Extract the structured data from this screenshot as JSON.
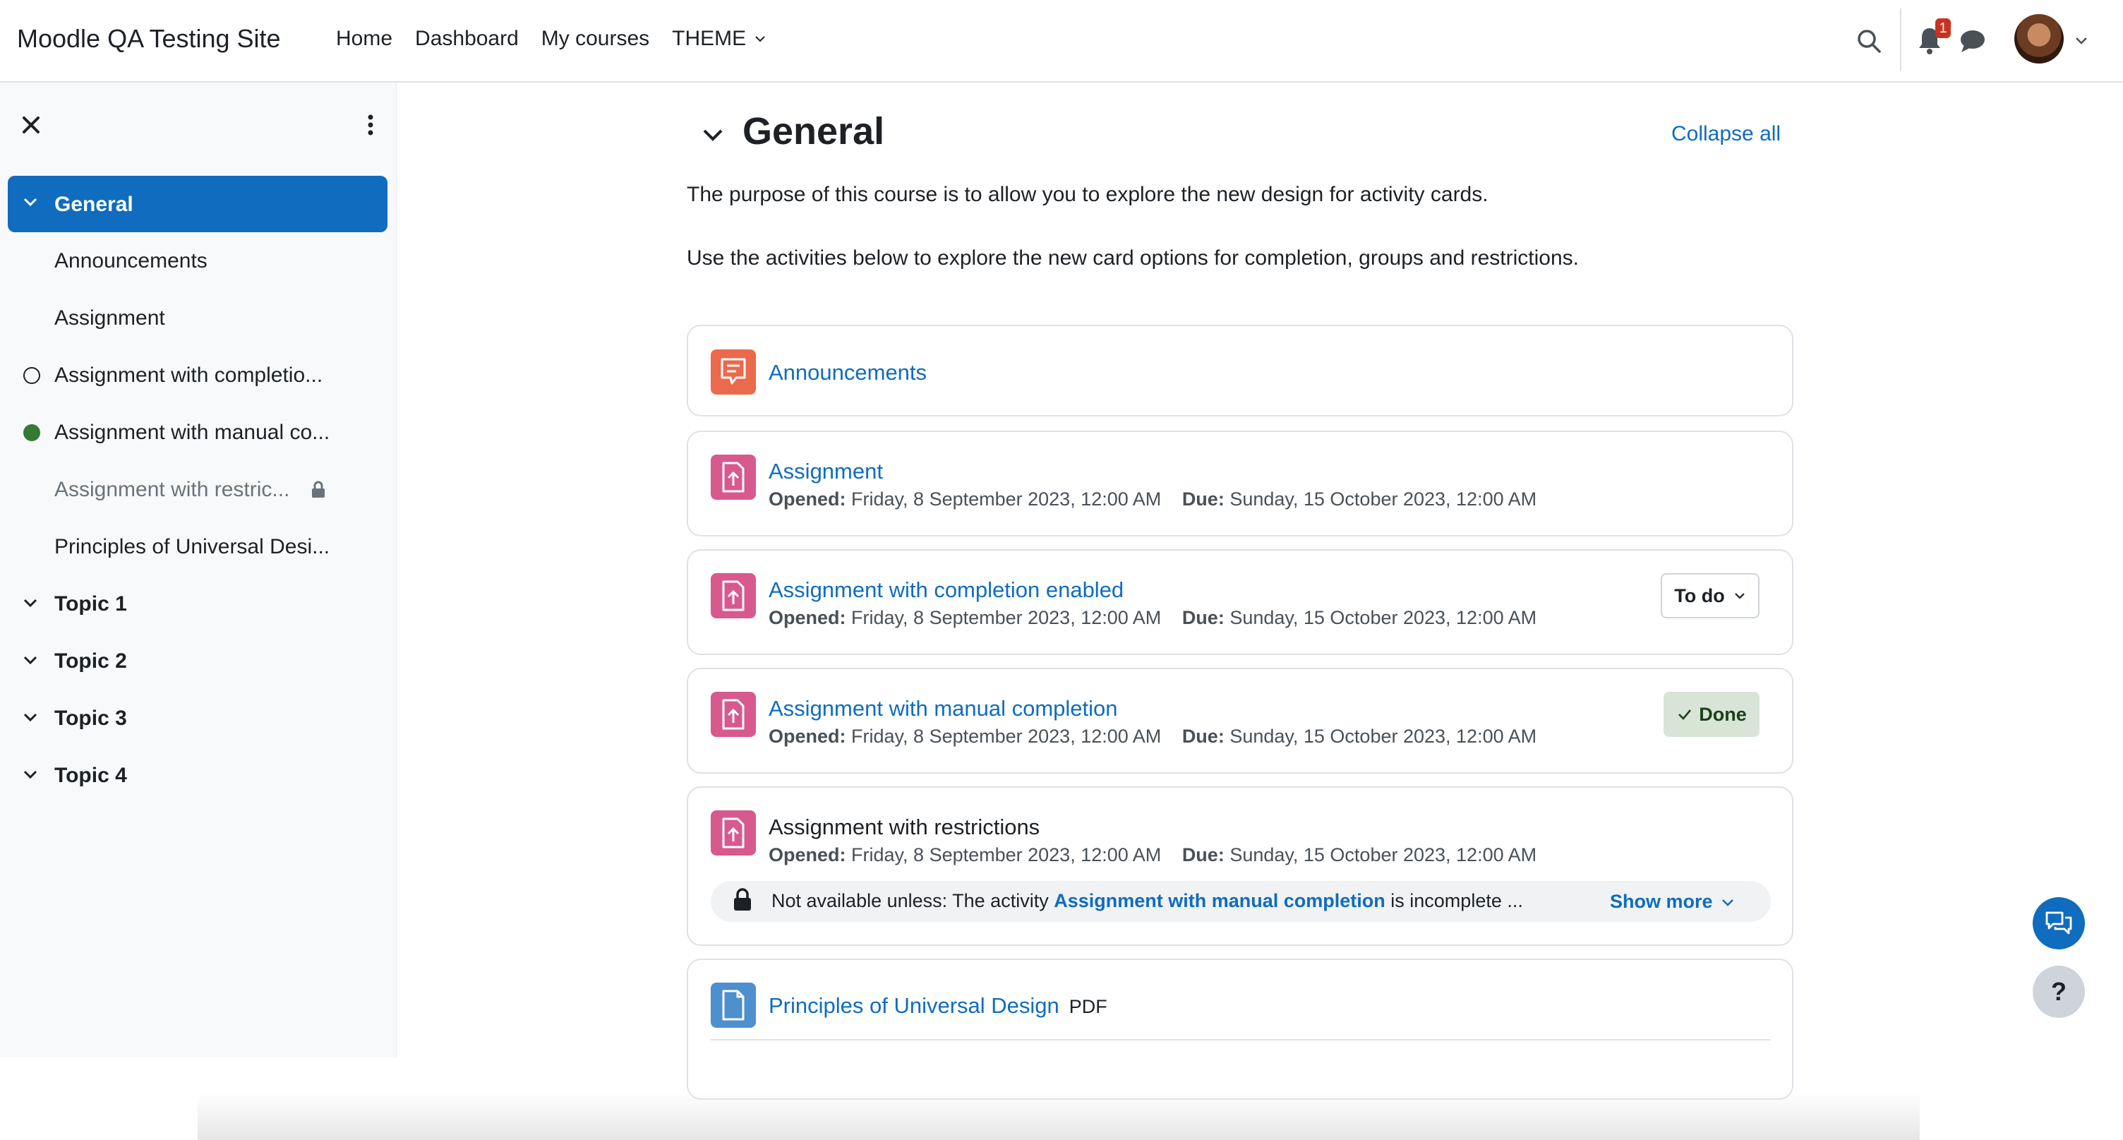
{
  "navbar": {
    "site_name": "Moodle QA Testing Site",
    "links": [
      "Home",
      "Dashboard",
      "My courses",
      "THEME"
    ],
    "notification_count": "1"
  },
  "drawer": {
    "items": [
      {
        "label": "General",
        "type": "section",
        "active": true
      },
      {
        "label": "Announcements",
        "type": "activity"
      },
      {
        "label": "Assignment",
        "type": "activity"
      },
      {
        "label": "Assignment with completio...",
        "type": "activity",
        "completion": "incomplete"
      },
      {
        "label": "Assignment with manual co...",
        "type": "activity",
        "completion": "complete"
      },
      {
        "label": "Assignment with restric...",
        "type": "activity",
        "restricted": true
      },
      {
        "label": "Principles of Universal Desi...",
        "type": "activity"
      },
      {
        "label": "Topic 1",
        "type": "section"
      },
      {
        "label": "Topic 2",
        "type": "section"
      },
      {
        "label": "Topic 3",
        "type": "section"
      },
      {
        "label": "Topic 4",
        "type": "section"
      }
    ]
  },
  "main": {
    "section_title": "General",
    "collapse_all": "Collapse all",
    "summary": [
      "The purpose of this course is to allow you to explore the new design for activity cards.",
      "Use the activities below to explore the new card options for completion, groups and restrictions."
    ],
    "activities": [
      {
        "name": "Announcements",
        "icon": "forum-icon"
      },
      {
        "name": "Assignment",
        "icon": "assignment-icon",
        "opened_label": "Opened:",
        "opened": "Friday, 8 September 2023, 12:00 AM",
        "due_label": "Due:",
        "due": "Sunday, 15 October 2023, 12:00 AM"
      },
      {
        "name": "Assignment with completion enabled",
        "icon": "assignment-icon",
        "opened_label": "Opened:",
        "opened": "Friday, 8 September 2023, 12:00 AM",
        "due_label": "Due:",
        "due": "Sunday, 15 October 2023, 12:00 AM",
        "completion": "To do"
      },
      {
        "name": "Assignment with manual completion",
        "icon": "assignment-icon",
        "opened_label": "Opened:",
        "opened": "Friday, 8 September 2023, 12:00 AM",
        "due_label": "Due:",
        "due": "Sunday, 15 October 2023, 12:00 AM",
        "completion": "Done"
      },
      {
        "name": "Assignment with restrictions",
        "icon": "assignment-icon",
        "opened_label": "Opened:",
        "opened": "Friday, 8 September 2023, 12:00 AM",
        "due_label": "Due:",
        "due": "Sunday, 15 October 2023, 12:00 AM",
        "restriction": {
          "prefix": "Not available unless: The activity",
          "link": "Assignment with manual completion",
          "suffix": "is incomplete ...",
          "show_more": "Show more"
        }
      },
      {
        "name": "Principles of Universal Design",
        "icon": "file-icon",
        "type_label": "PDF"
      }
    ]
  },
  "fab": {
    "help": "?"
  },
  "colors": {
    "brand": "#0f6cbf",
    "forum": "#eb6a4d",
    "assignment": "#d8598e",
    "resource": "#4e8fcf",
    "done_bg": "#d7e4d6"
  }
}
